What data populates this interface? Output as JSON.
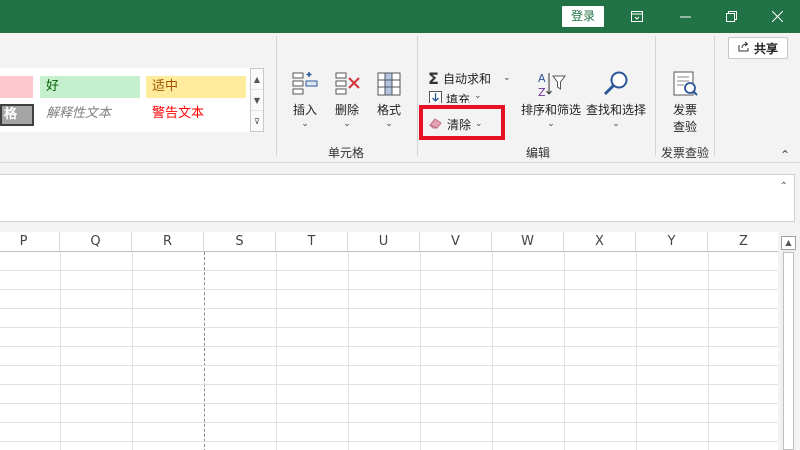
{
  "titlebar": {
    "login_label": "登录",
    "icons": [
      "ribbon-display-icon",
      "minimize-icon",
      "restore-icon",
      "close-icon"
    ],
    "color": "#217346"
  },
  "ribbon": {
    "share_label": "共享",
    "styles": {
      "bad_partial": "",
      "good": "好",
      "neutral": "适中",
      "check_partial": "格",
      "explanatory": "解释性文本",
      "warning": "警告文本"
    },
    "cells_group": {
      "label": "单元格",
      "insert": "插入",
      "delete": "删除",
      "format": "格式"
    },
    "edit_group": {
      "label": "编辑",
      "autosum": "自动求和",
      "fill": "填充",
      "clear": "清除",
      "sort_filter": "排序和筛选",
      "find_select": "查找和选择"
    },
    "invoice_group": {
      "label": "发票查验",
      "button_line1": "发票",
      "button_line2": "查验"
    }
  },
  "grid": {
    "columns": [
      "P",
      "Q",
      "R",
      "S",
      "T",
      "U",
      "V",
      "W",
      "X",
      "Y",
      "Z"
    ]
  },
  "colors": {
    "highlight": "#e81123",
    "accent": "#217346"
  }
}
